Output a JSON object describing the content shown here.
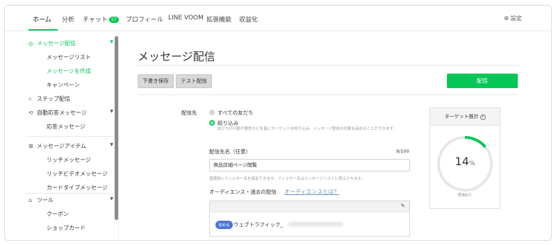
{
  "nav": {
    "tabs": [
      "ホーム",
      "分析",
      "チャット",
      "プロフィール",
      "LINE VOOM",
      "拡張機能",
      "収益化"
    ],
    "chat_badge": "57",
    "settings_label": "設定"
  },
  "sidebar": {
    "message_delivery": "メッセージ配信",
    "message_list": "メッセージリスト",
    "create_message": "メッセージを作成",
    "campaign": "キャンペーン",
    "step_delivery": "ステップ配信",
    "auto_reply": "自動応答メッセージ",
    "reply_message": "応答メッセージ",
    "message_items": "メッセージアイテム",
    "rich_message": "リッチメッセージ",
    "rich_video": "リッチビデオメッセージ",
    "card_type": "カードタイプメッセージ",
    "tools": "ツール",
    "coupon": "クーポン",
    "shop_card": "ショップカード"
  },
  "main": {
    "title": "メッセージ配信",
    "save_draft": "下書き保存",
    "test_delivery": "テスト配信",
    "deliver": "配信",
    "recipient_label": "配信先",
    "all_friends": "すべての友だち",
    "narrow": "絞り込み",
    "narrow_hint": "友だちの行動や属性などを基にターゲットを絞り込み、メッセージ配信の効果を高めることができます。",
    "recipient_name_label": "配信先名（任意）",
    "counter": "9/100",
    "recipient_name_value": "商品詳細ページ閲覧",
    "filter_hint": "管理用にフィルター名を設定できます。フィルター名はメッセージリストに表示されます。",
    "audience_label": "オーディエンス・過去の配信",
    "audience_link": "オーディエンスとは？",
    "include_chip": "含める",
    "audience_name": "ウェブトラフィック_"
  },
  "target": {
    "title": "ターゲット推計",
    "percent": "14",
    "percent_unit": "%",
    "percent_value": 14,
    "approx_prefix": "約",
    "approx_count": "89",
    "approx_suffix": "人",
    "ring_color": "#06c755"
  }
}
